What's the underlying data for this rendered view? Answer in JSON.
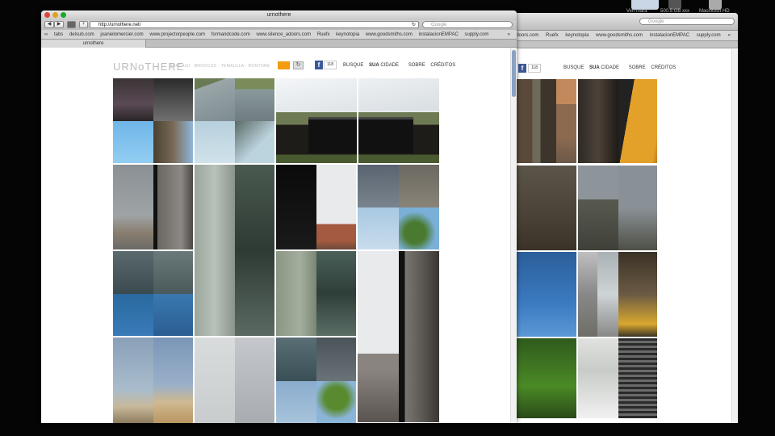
{
  "desktop": {
    "icons": [
      {
        "label": "Vim Inara",
        "name": "drive-icon-1"
      },
      {
        "label": "500.5 GB xxx",
        "name": "drive-icon-2"
      },
      {
        "label": "Macintosh HD",
        "name": "drive-icon-3"
      }
    ]
  },
  "browser": {
    "title": "urnothere",
    "url": "http://urnothere.net/",
    "search_placeholder": "Google",
    "bookmarks": [
      "tabs",
      "delsub.com",
      "joanielomercier.com",
      "www.projectorpeople.com",
      "formandcode.com",
      "www.silence_adoors.com",
      "Ruefx",
      "keynotopia",
      "www.goodsmiths.com",
      "instalacionEMPAC",
      "supply.com"
    ],
    "tab_label": "urnothere",
    "nav_buttons": {
      "back": "◀",
      "forward": "▶",
      "add": "+"
    }
  },
  "site": {
    "logo": "URNoTHERE",
    "subnav": "ARACAJU · BROOCOS · TEMAULLA · RONTORE",
    "refresh_icon": "↻",
    "fb_letter": "f",
    "like_count": "118",
    "nav": [
      {
        "text": "BUSQUE",
        "bold": "SUA",
        "rest": "CIDADE"
      },
      {
        "text": "SOBRE"
      },
      {
        "text": "CRÉDITOS"
      }
    ]
  },
  "back_window": {
    "search_placeholder": "Google",
    "bookmarks": [
      "adoors.com",
      "Ruefx",
      "keynotopia",
      "www.goodsmiths.com",
      "instalacionEMPAC",
      "supply.com"
    ],
    "like_count": "118",
    "nav": [
      "BUSQUE",
      "SUA",
      "CIDADE",
      "SOBRE",
      "CRÉDITOS"
    ]
  },
  "colors": {
    "accent": "#f39c12",
    "facebook": "#3b5998"
  }
}
